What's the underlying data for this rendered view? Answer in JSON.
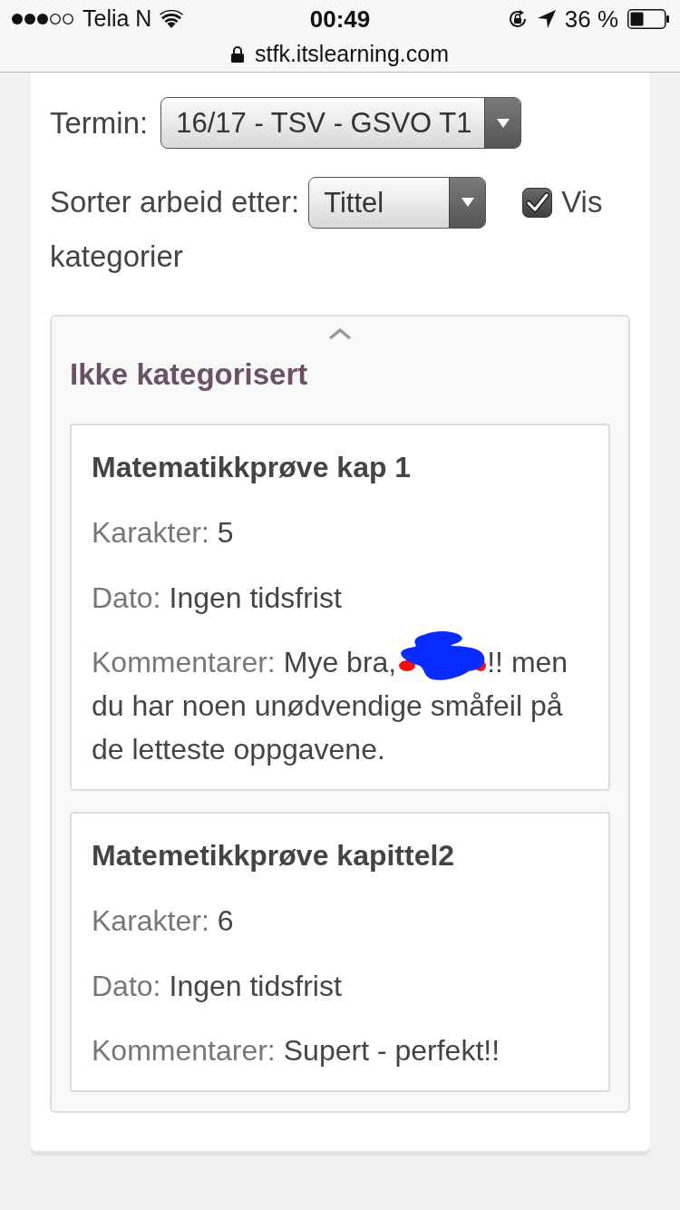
{
  "status_bar": {
    "carrier": "Telia N",
    "time": "00:49",
    "battery": "36 %"
  },
  "address_bar": {
    "url": "stfk.itslearning.com"
  },
  "filters": {
    "term": {
      "label": "Termin:",
      "value": "16/17 - TSV - GSVO T1"
    },
    "sort": {
      "label": "Sorter arbeid etter:",
      "value": "Tittel"
    },
    "show_categories": {
      "label": "Vis",
      "label_continued": "kategorier",
      "checked": true
    }
  },
  "categories": [
    {
      "title": "Ikke kategorisert",
      "expanded": true,
      "assignments": [
        {
          "title": "Matematikkprøve kap 1",
          "grade": {
            "label": "Karakter:",
            "value": "5"
          },
          "date": {
            "label": "Dato:",
            "value": "Ingen tidsfrist"
          },
          "comment": {
            "label": "Kommentarer:",
            "parts": [
              {
                "kind": "text",
                "text": "Mye bra,"
              },
              {
                "kind": "redaction"
              },
              {
                "kind": "text",
                "text": "!! men"
              },
              {
                "kind": "continuation",
                "text": "du har noen unødvendige småfeil på de letteste oppgavene."
              }
            ]
          }
        },
        {
          "title": "Matemetikkprøve kapittel2",
          "grade": {
            "label": "Karakter:",
            "value": "6"
          },
          "date": {
            "label": "Dato:",
            "value": "Ingen tidsfrist"
          },
          "comment": {
            "label": "Kommentarer:",
            "parts": [
              {
                "kind": "text",
                "text": "Supert - perfekt!!"
              }
            ]
          }
        }
      ]
    }
  ]
}
